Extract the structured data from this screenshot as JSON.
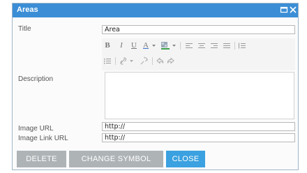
{
  "dialog": {
    "title": "Areas",
    "controls": {
      "maximize_icon": "maximize-icon",
      "close_icon": "close-icon"
    }
  },
  "form": {
    "title_label": "Title",
    "title_value": "Area",
    "description_label": "Description",
    "description_value": "",
    "image_url_label": "Image URL",
    "image_url_value": "http://",
    "image_link_url_label": "Image Link URL",
    "image_link_url_value": "http://"
  },
  "toolbar": {
    "bold": "B",
    "italic": "I",
    "underline": "U",
    "font_color": "A"
  },
  "buttons": {
    "delete": "DELETE",
    "change_symbol": "CHANGE SYMBOL",
    "close": "CLOSE"
  },
  "colors": {
    "titlebar": "#3b8ed6",
    "primary_button": "#3ba1e0",
    "secondary_button": "#aeb3b6"
  }
}
